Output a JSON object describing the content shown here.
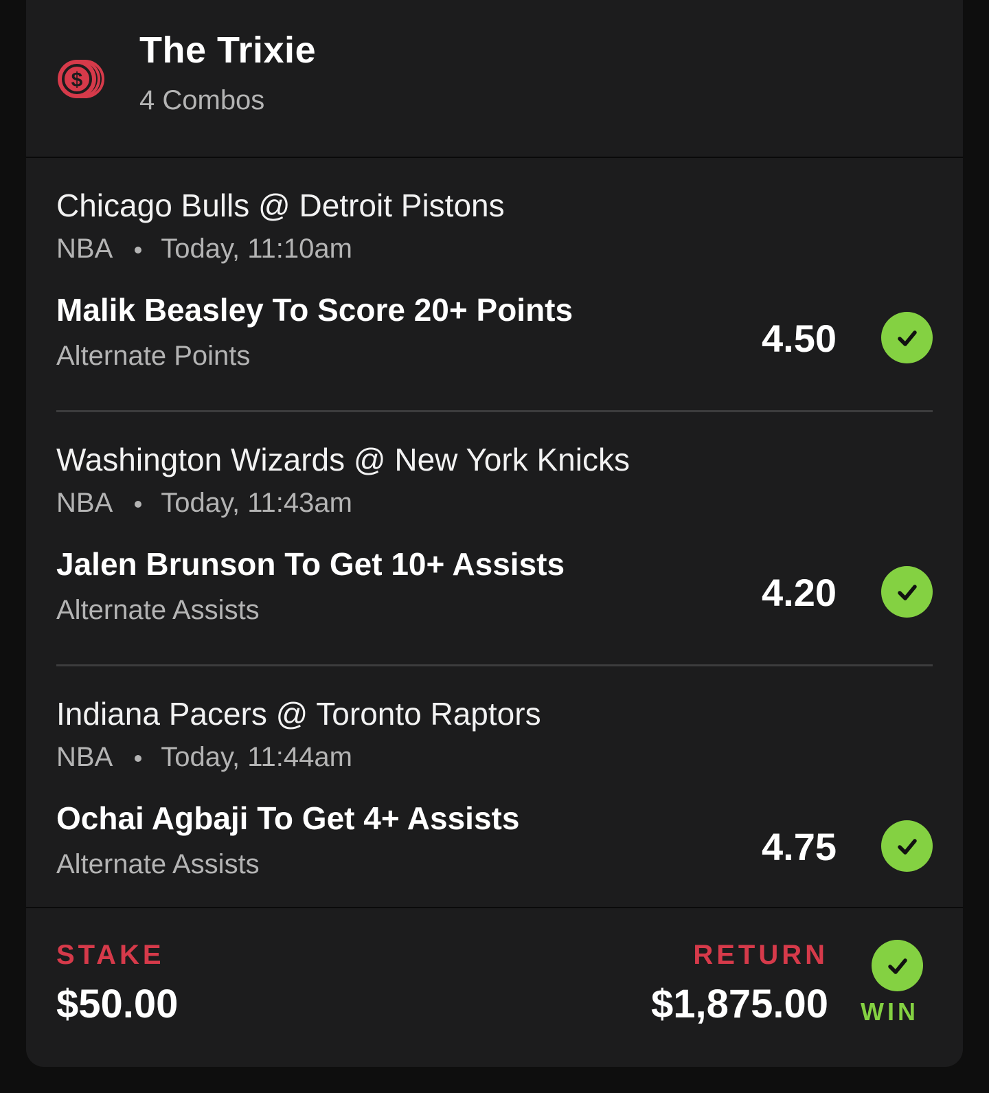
{
  "bet": {
    "title": "The Trixie",
    "subtitle": "4 Combos",
    "icon": "coins-icon",
    "accent_color": "#d63a4a",
    "win_color": "#84d142"
  },
  "legs": [
    {
      "match": "Chicago Bulls @ Detroit Pistons",
      "league": "NBA",
      "time": "Today, 11:10am",
      "selection": "Malik Beasley To Score 20+ Points",
      "market": "Alternate Points",
      "odds": "4.50",
      "status_icon": "check-icon"
    },
    {
      "match": "Washington Wizards @ New York Knicks",
      "league": "NBA",
      "time": "Today, 11:43am",
      "selection": "Jalen Brunson To Get 10+ Assists",
      "market": "Alternate Assists",
      "odds": "4.20",
      "status_icon": "check-icon"
    },
    {
      "match": "Indiana Pacers @ Toronto Raptors",
      "league": "NBA",
      "time": "Today, 11:44am",
      "selection": "Ochai Agbaji To Get 4+ Assists",
      "market": "Alternate Assists",
      "odds": "4.75",
      "status_icon": "check-icon"
    }
  ],
  "footer": {
    "stake_label": "STAKE",
    "stake_amount": "$50.00",
    "return_label": "RETURN",
    "return_amount": "$1,875.00",
    "result": "WIN"
  }
}
